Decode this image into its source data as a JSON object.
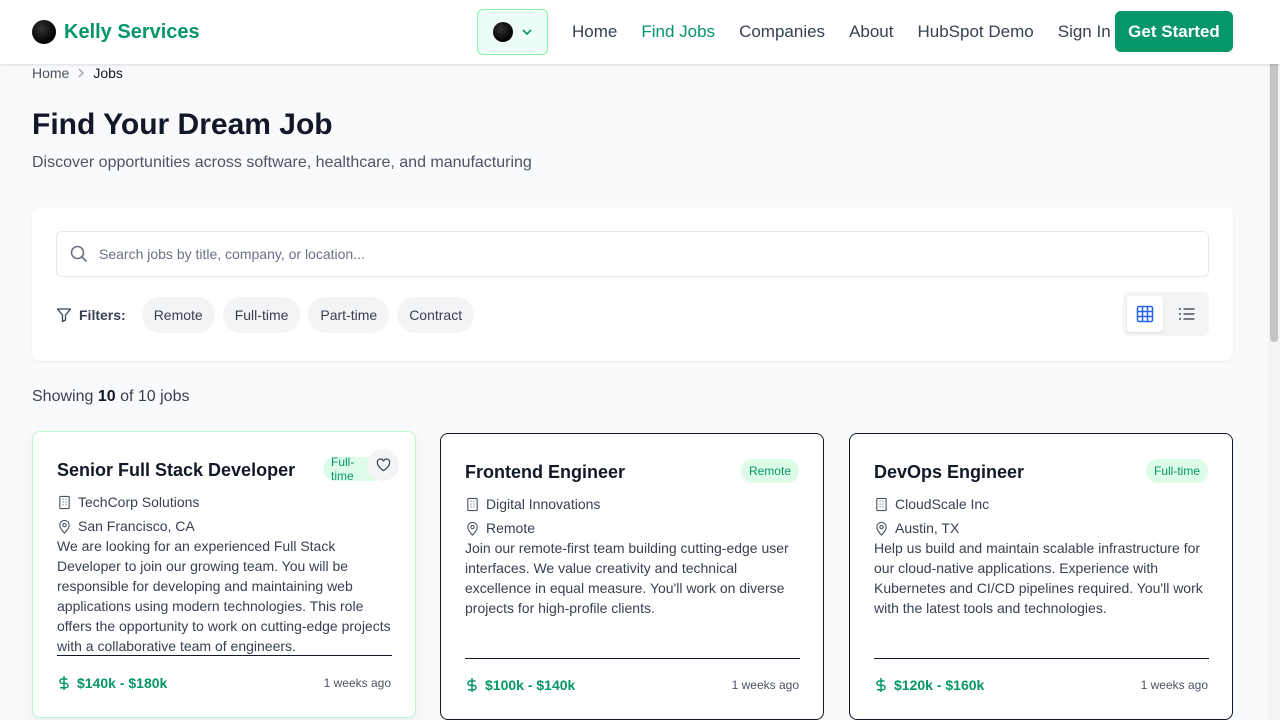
{
  "header": {
    "brand": "Kelly Services",
    "nav": [
      "Home",
      "Find Jobs",
      "Companies",
      "About",
      "HubSpot Demo",
      "Sign In"
    ],
    "active_nav": "Find Jobs",
    "cta": "Get Started"
  },
  "breadcrumb": {
    "home": "Home",
    "current": "Jobs"
  },
  "page": {
    "title": "Find Your Dream Job",
    "subtitle": "Discover opportunities across software, healthcare, and manufacturing"
  },
  "search": {
    "placeholder": "Search jobs by title, company, or location...",
    "value": ""
  },
  "filters": {
    "label": "Filters:",
    "chips": [
      "Remote",
      "Full-time",
      "Part-time",
      "Contract"
    ]
  },
  "results": {
    "prefix": "Showing",
    "shown": "10",
    "suffix": "of 10 jobs"
  },
  "jobs": [
    {
      "title": "Senior Full Stack Developer",
      "badge": "Full-time",
      "company": "TechCorp Solutions",
      "location": "San Francisco, CA",
      "description": "We are looking for an experienced Full Stack Developer to join our growing team. You will be responsible for developing and maintaining web applications using modern technologies. This role offers the opportunity to work on cutting-edge projects with a collaborative team of engineers.",
      "salary": "$140k - $180k",
      "posted": "1 weeks ago"
    },
    {
      "title": "Frontend Engineer",
      "badge": "Remote",
      "company": "Digital Innovations",
      "location": "Remote",
      "description": "Join our remote-first team building cutting-edge user interfaces. We value creativity and technical excellence in equal measure. You'll work on diverse projects for high-profile clients.",
      "salary": "$100k - $140k",
      "posted": "1 weeks ago"
    },
    {
      "title": "DevOps Engineer",
      "badge": "Full-time",
      "company": "CloudScale Inc",
      "location": "Austin, TX",
      "description": "Help us build and maintain scalable infrastructure for our cloud-native applications. Experience with Kubernetes and CI/CD pipelines required. You'll work with the latest tools and technologies.",
      "salary": "$120k - $160k",
      "posted": "1 weeks ago"
    }
  ],
  "colors": {
    "brand": "#059669",
    "badge_bg": "#dcfce7",
    "page_bg": "#f9fafb"
  },
  "icons": [
    "theme-toggle-icon",
    "chevron-down-icon",
    "chevron-right-icon",
    "search-icon",
    "filter-icon",
    "grid-view-icon",
    "list-view-icon",
    "building-icon",
    "map-pin-icon",
    "heart-icon",
    "dollar-icon"
  ]
}
